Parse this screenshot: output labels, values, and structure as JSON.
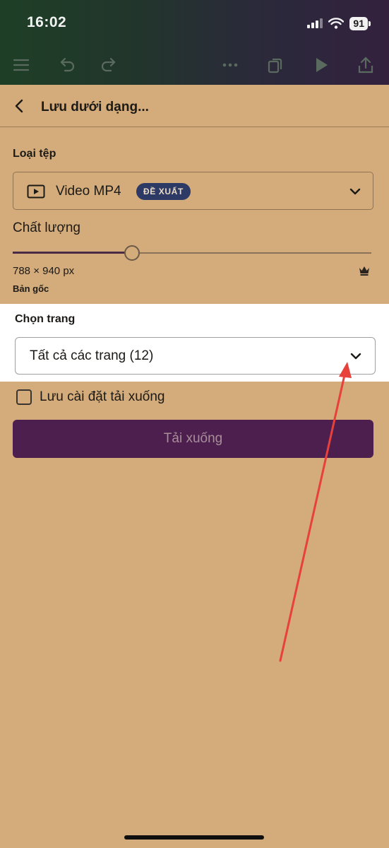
{
  "status_bar": {
    "time": "16:02",
    "battery": "91",
    "icons": [
      "signal-icon",
      "wifi-icon",
      "battery-icon"
    ]
  },
  "toolbar": {
    "icons": [
      "menu-icon",
      "undo-icon",
      "redo-icon",
      "more-icon",
      "pages-icon",
      "play-icon",
      "share-icon"
    ]
  },
  "sheet": {
    "title": "Lưu dưới dạng...",
    "file_type": {
      "label": "Loại tệp",
      "value": "Video MP4",
      "badge": "ĐỀ XUẤT"
    },
    "quality": {
      "label": "Chất lượng",
      "level": 0.33,
      "dimensions": "788 × 940 px",
      "original_label": "Bản gốc"
    },
    "pages": {
      "label": "Chọn trang",
      "value": "Tất cả các trang (12)"
    },
    "save_settings": {
      "label": "Lưu cài đặt tải xuống",
      "checked": false
    },
    "download_button": "Tải xuống"
  },
  "colors": {
    "sheet_background": "#d4ab7a",
    "download_button": "#4c1f4f",
    "badge": "#2d3a66",
    "annotation_arrow": "#e8403a"
  }
}
